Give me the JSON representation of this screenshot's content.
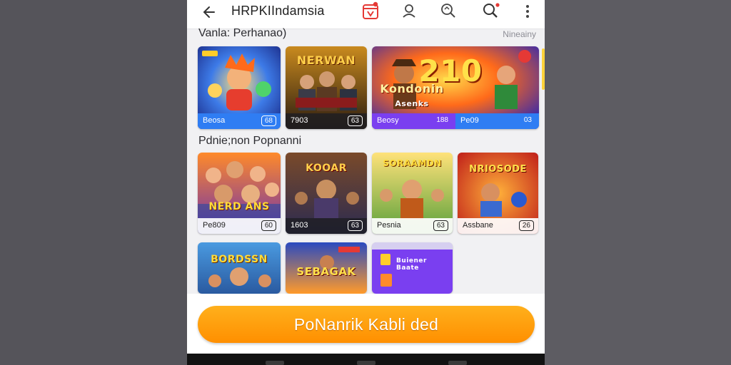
{
  "header": {
    "back_icon": "arrow-left-icon",
    "title": "HRPKIIndamsia",
    "actions": [
      "calendar-icon",
      "user-icon",
      "scan-icon",
      "search-icon",
      "more-vertical-icon"
    ]
  },
  "sections": [
    {
      "title": "Vanla: Perhanao)",
      "link": "Nineainy",
      "cards": [
        {
          "art_title": "",
          "name": "Beosa",
          "count": "68"
        },
        {
          "art_title": "NERWAN",
          "name": "7903",
          "count": "63"
        },
        {
          "art_title": "210",
          "subtitle": "Kondonin",
          "subtitle2": "Asenks",
          "name": "Beosy",
          "count": "188"
        },
        {
          "art_title": "",
          "name": "Pe09",
          "count": "03"
        }
      ]
    },
    {
      "title": "Pdnie;non Popnanni",
      "cards": [
        {
          "art_title": "NERD ANS",
          "name": "Pe809",
          "count": "60"
        },
        {
          "art_title": "KOOAR",
          "name": "1603",
          "count": "63"
        },
        {
          "art_title": "SORAAMDN",
          "name": "Pesnia",
          "count": "63"
        },
        {
          "art_title": "NRIOSODE",
          "name": "Assbane",
          "count": "26"
        }
      ]
    },
    {
      "cards": [
        {
          "art_title": "BORDSSN"
        },
        {
          "art_title": "SEBAGAK"
        },
        {
          "art_title": "Buiener Baate"
        }
      ]
    }
  ],
  "cta": {
    "label": "PoNanrik Kabli ded"
  },
  "colors": {
    "accent": "#ff9a00",
    "violet": "#7a3ff0",
    "blue": "#2f7df3"
  }
}
